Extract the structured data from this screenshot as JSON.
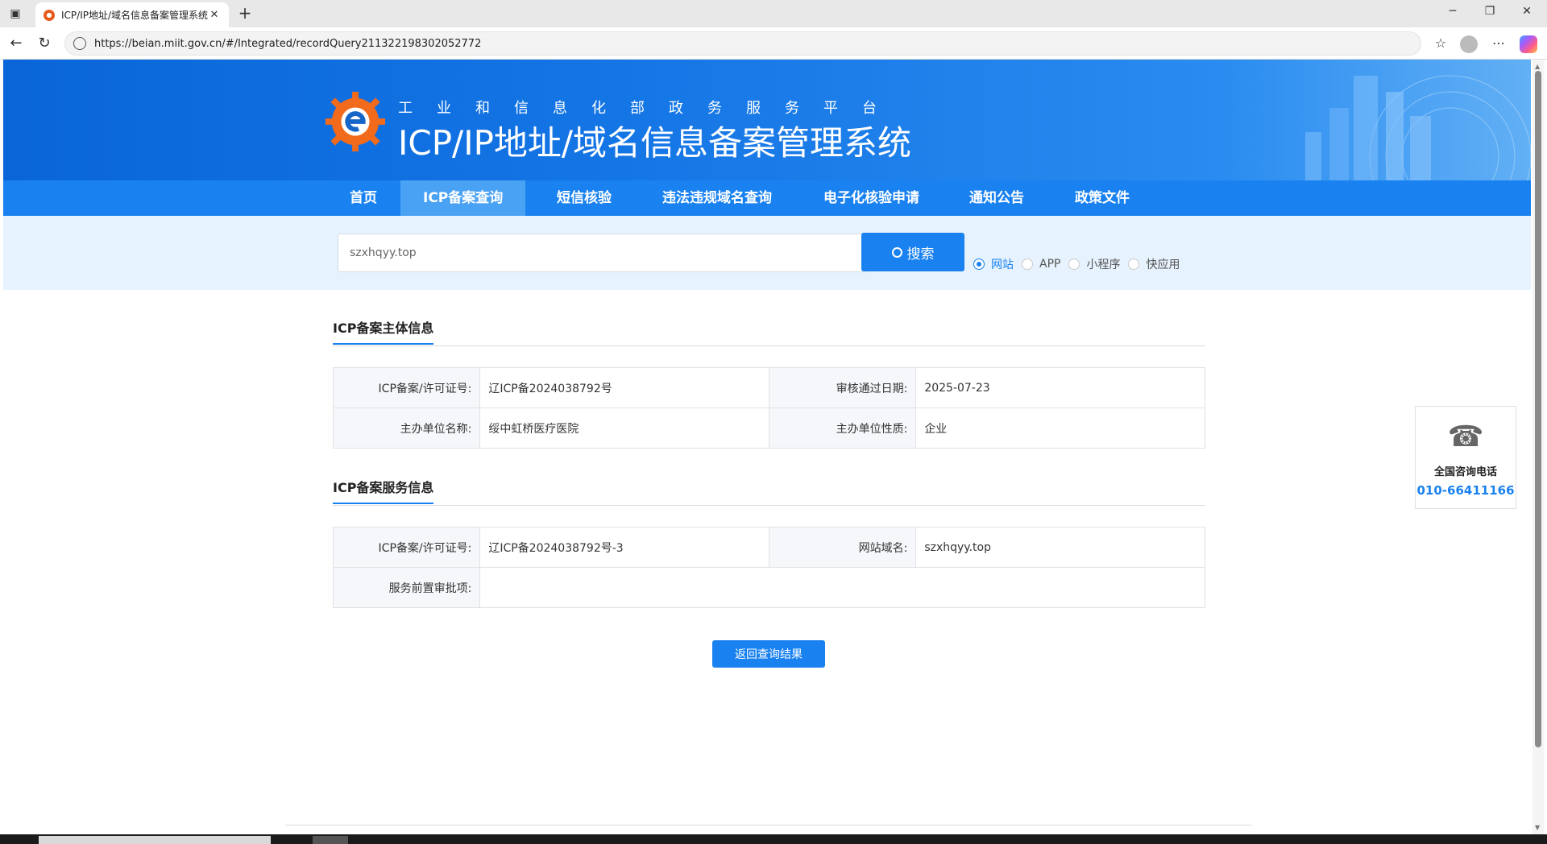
{
  "browser": {
    "tab_title": "ICP/IP地址/域名信息备案管理系统",
    "url": "https://beian.miit.gov.cn/#/Integrated/recordQuery211322198302052772"
  },
  "header": {
    "subtitle": "工业和信息化部政务服务平台",
    "title": "ICP/IP地址/域名信息备案管理系统"
  },
  "nav": {
    "items": [
      "首页",
      "ICP备案查询",
      "短信核验",
      "违法违规域名查询",
      "电子化核验申请",
      "通知公告",
      "政策文件"
    ],
    "active": "ICP备案查询"
  },
  "search": {
    "value": "szxhqyy.top",
    "button_label": "搜索",
    "options": [
      "网站",
      "APP",
      "小程序",
      "快应用"
    ],
    "selected": "网站"
  },
  "subject_section": {
    "title": "ICP备案主体信息",
    "rows": [
      {
        "label1": "ICP备案/许可证号:",
        "value1": "辽ICP备2024038792号",
        "label2": "审核通过日期:",
        "value2": "2025-07-23"
      },
      {
        "label1": "主办单位名称:",
        "value1": "绥中虹桥医疗医院",
        "label2": "主办单位性质:",
        "value2": "企业"
      }
    ]
  },
  "service_section": {
    "title": "ICP备案服务信息",
    "row1": {
      "label1": "ICP备案/许可证号:",
      "value1": "辽ICP备2024038792号-3",
      "label2": "网站域名:",
      "value2": "szxhqyy.top"
    },
    "row2": {
      "label": "服务前置审批项:",
      "value": ""
    }
  },
  "back_button": "返回查询结果",
  "hotline": {
    "label": "全国咨询电话",
    "number": "010-66411166"
  },
  "colors": {
    "primary": "#1a82f0",
    "banner": "#0a66d8",
    "search_band": "#e6f2fd"
  }
}
